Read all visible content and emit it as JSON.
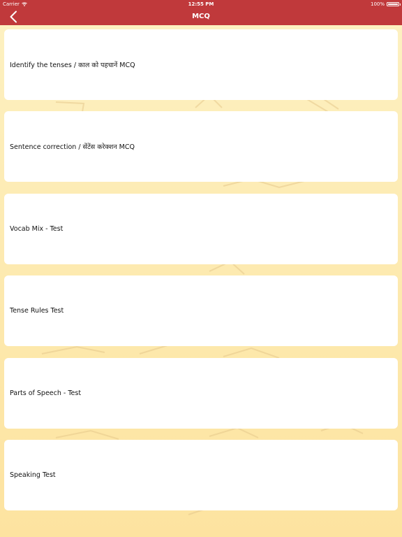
{
  "status_bar": {
    "carrier": "Carrier",
    "time": "12:55 PM",
    "battery": "100%",
    "battery_level": 1.0
  },
  "nav": {
    "title": "MCQ",
    "back_icon": "chevron-left-icon"
  },
  "items": [
    {
      "label": "Identify the tenses / काल को पहचानें MCQ"
    },
    {
      "label": "Sentence correction  /  सेंटेंस करेक्शन MCQ"
    },
    {
      "label": "Vocab Mix - Test"
    },
    {
      "label": "Tense Rules Test"
    },
    {
      "label": "Parts of Speech - Test"
    },
    {
      "label": "Speaking Test"
    }
  ],
  "colors": {
    "nav_background": "#c0393b",
    "background_top": "#fdf1c2",
    "background_bottom": "#fde3a0",
    "card": "#ffffff"
  }
}
